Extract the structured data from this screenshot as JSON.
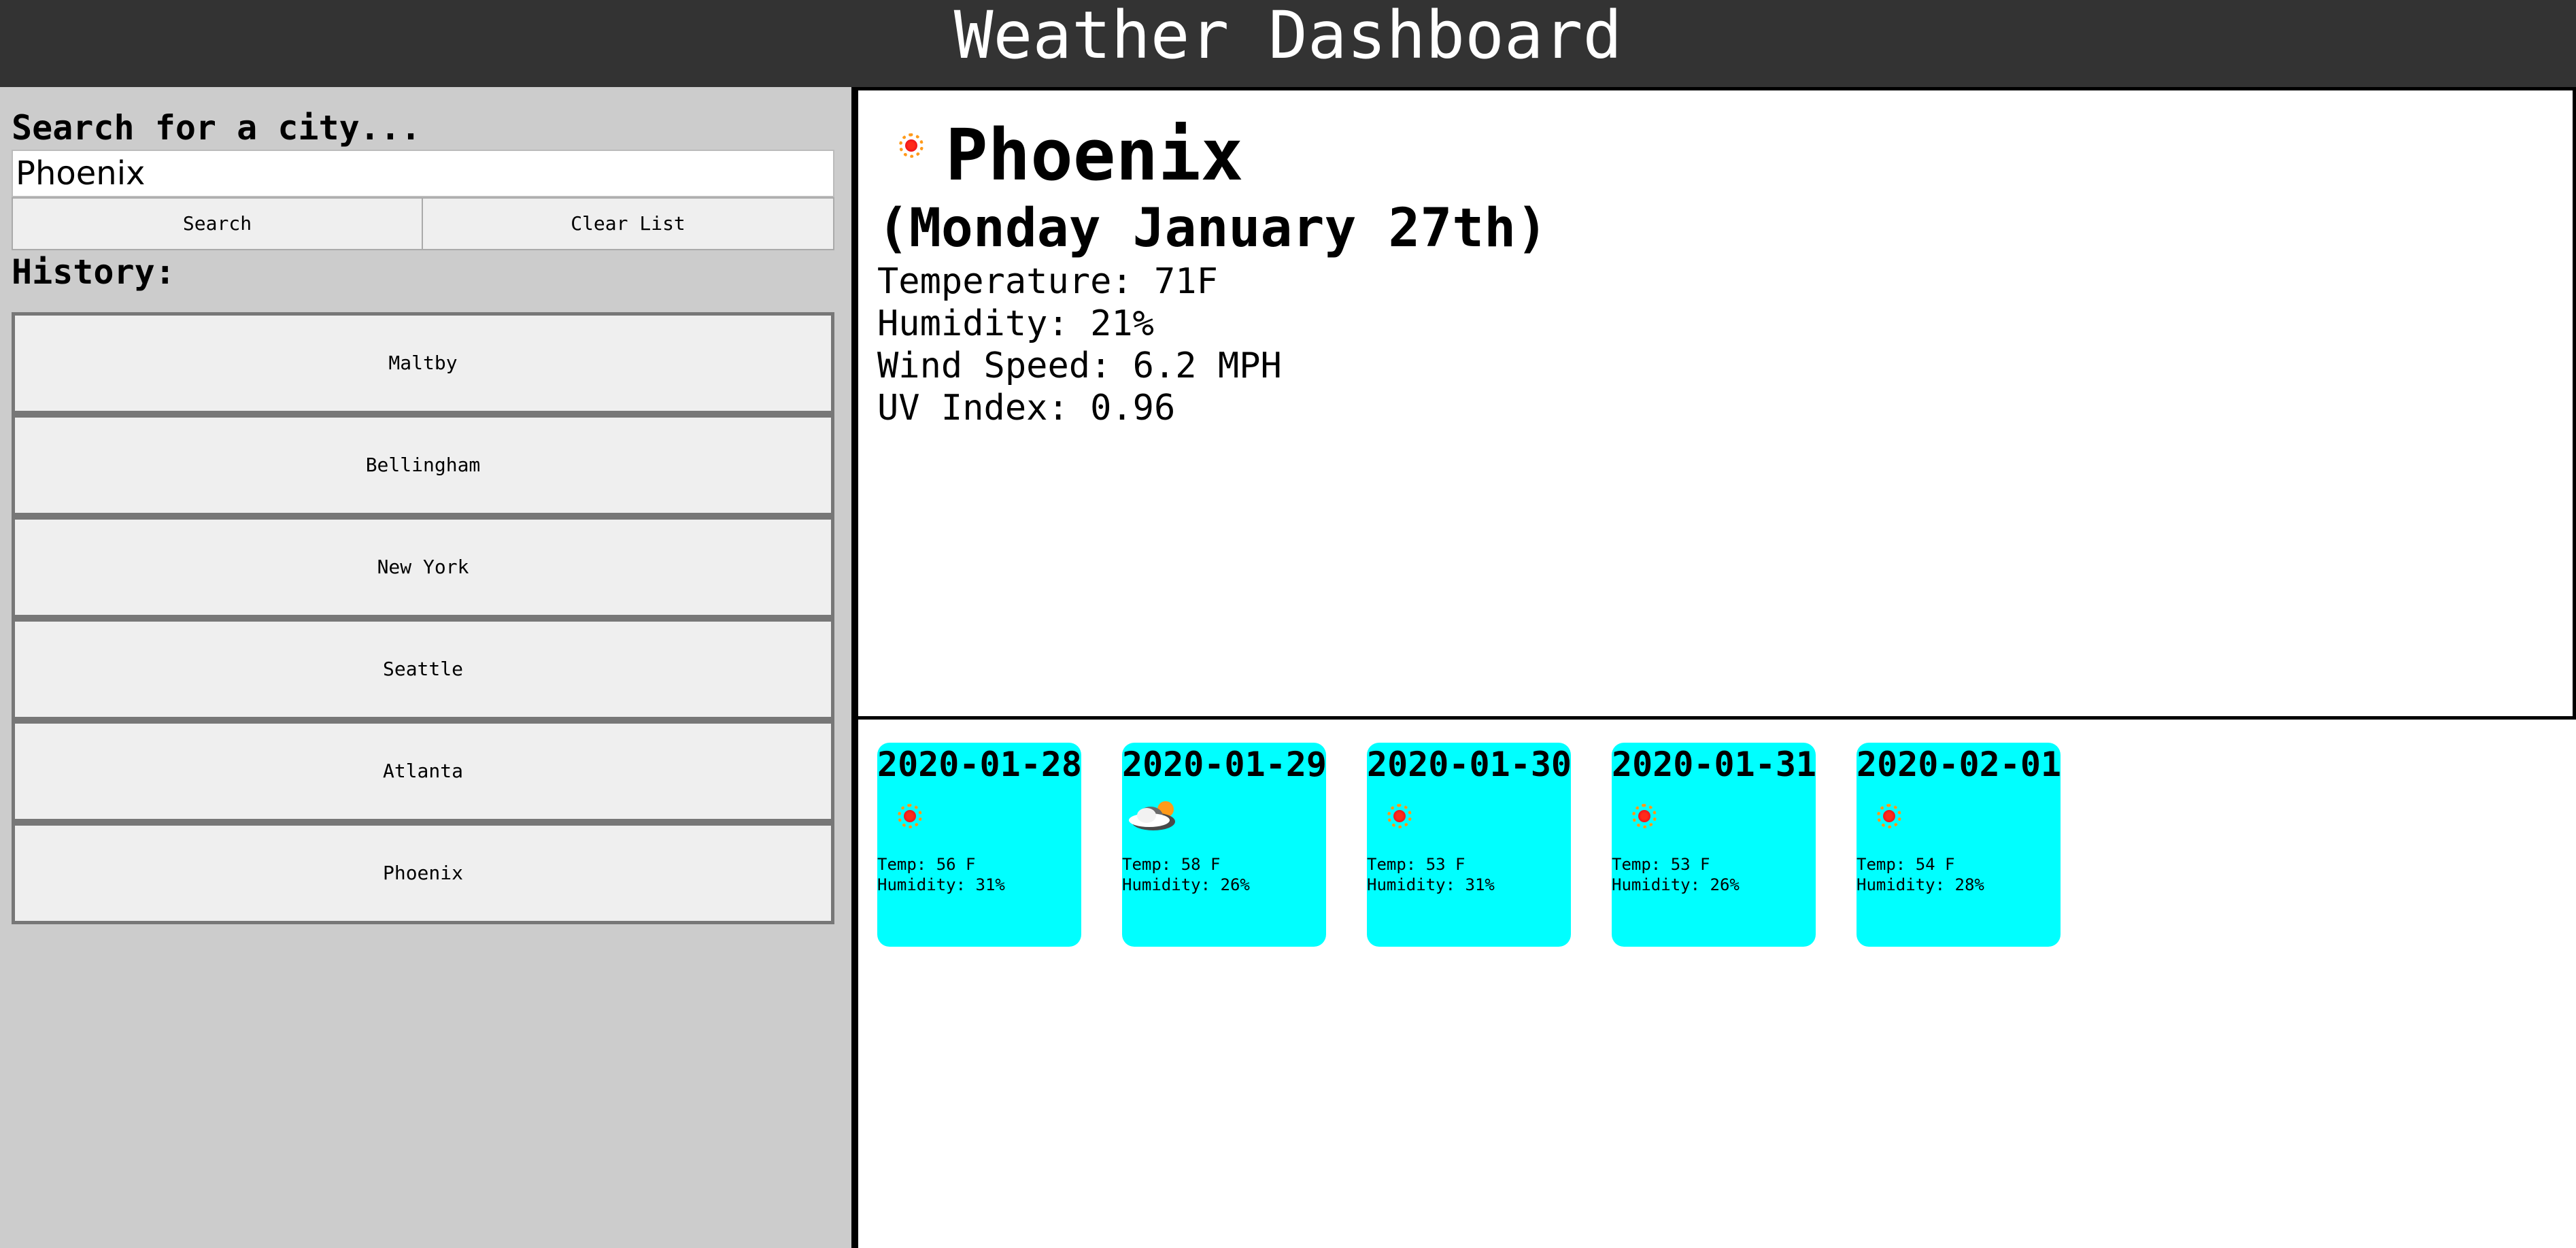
{
  "header": {
    "title": "Weather Dashboard"
  },
  "sidebar": {
    "search_label": "Search for a city...",
    "search_value": "Phoenix",
    "search_button": "Search",
    "clear_button": "Clear List",
    "history_label": "History:",
    "history": [
      "Maltby",
      "Bellingham",
      "New York",
      "Seattle",
      "Atlanta",
      "Phoenix"
    ]
  },
  "current": {
    "icon": "sun-icon",
    "city": "Phoenix",
    "date": "(Monday January 27th)",
    "temperature": "Temperature: 71F",
    "humidity": "Humidity: 21%",
    "wind": "Wind Speed: 6.2 MPH",
    "uv": "UV Index: 0.96"
  },
  "forecast": [
    {
      "date": "2020-01-28",
      "icon": "sun-icon",
      "temp": "Temp: 56 F",
      "humidity": "Humidity: 31%"
    },
    {
      "date": "2020-01-29",
      "icon": "cloud-sun-icon",
      "temp": "Temp: 58 F",
      "humidity": "Humidity: 26%"
    },
    {
      "date": "2020-01-30",
      "icon": "sun-icon",
      "temp": "Temp: 53 F",
      "humidity": "Humidity: 31%"
    },
    {
      "date": "2020-01-31",
      "icon": "sun-icon",
      "temp": "Temp: 53 F",
      "humidity": "Humidity: 26%"
    },
    {
      "date": "2020-02-01",
      "icon": "sun-icon",
      "temp": "Temp: 54 F",
      "humidity": "Humidity: 28%"
    }
  ],
  "colors": {
    "header_bg": "#333333",
    "sidebar_bg": "#cccccc",
    "card_bg": "#00ffff"
  }
}
